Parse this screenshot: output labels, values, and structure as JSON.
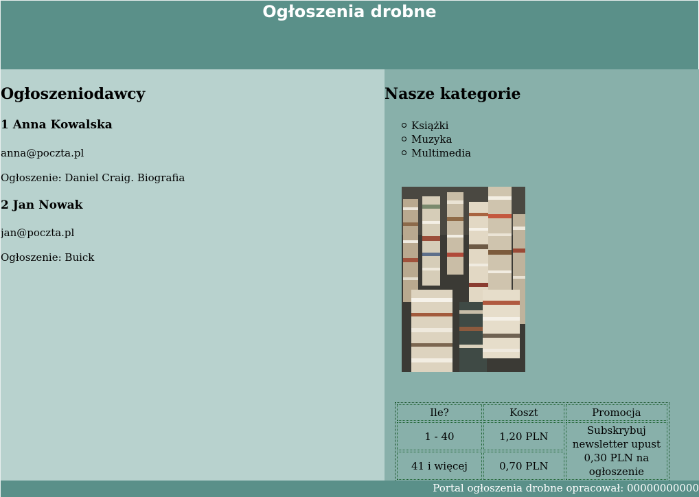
{
  "header": {
    "title": "Ogłoszenia drobne"
  },
  "left": {
    "heading": "Ogłoszeniodawcy",
    "advertisers": [
      {
        "name": "1 Anna Kowalska",
        "email": "anna@poczta.pl",
        "ad": "Ogłoszenie: Daniel Craig. Biografia"
      },
      {
        "name": "2 Jan Nowak",
        "email": "jan@poczta.pl",
        "ad": "Ogłoszenie: Buick"
      }
    ]
  },
  "right": {
    "heading": "Nasze kategorie",
    "categories": [
      "Książki",
      "Muzyka",
      "Multimedia"
    ],
    "image": {
      "subject": "stacks of books"
    },
    "pricing": {
      "headers": [
        "Ile?",
        "Koszt",
        "Promocja"
      ],
      "rows": [
        {
          "range": "1 - 40",
          "cost": "1,20 PLN"
        },
        {
          "range": "41 i więcej",
          "cost": "0,70 PLN"
        }
      ],
      "promotion": "Subskrybuj newsletter upust 0,30 PLN na ogłoszenie"
    }
  },
  "footer": {
    "text": "Portal ogłoszenia drobne opracował: 00000000000"
  },
  "colors": {
    "header_bg": "#5a9089",
    "left_bg": "#b8d2ce",
    "right_bg": "#88b0aa",
    "footer_bg": "#5a9089",
    "table_border": "#1c6230"
  }
}
